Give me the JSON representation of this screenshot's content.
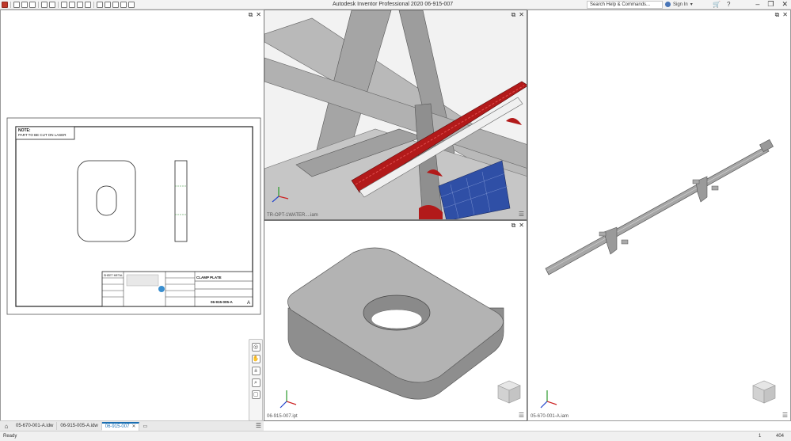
{
  "app": {
    "title": "Autodesk Inventor Professional 2020   06-915-007",
    "search_placeholder": "Search Help & Commands...",
    "user_name": "Sign In"
  },
  "drawing": {
    "note_title": "NOTE:",
    "note_text": "PART TO BE CUT ON LASER",
    "title_block": {
      "part_name": "CLAMP PLATE",
      "sheet_metal_label": "SHEET METAL",
      "drawing_number": "06-915-005-A",
      "revision": "A"
    }
  },
  "panes": {
    "top_center_label": "TR-OPT-1WATER....iam",
    "bottom_center_label": "06-915-007.ipt",
    "right_label": "05-670-001-A.iam"
  },
  "doc_tabs": [
    {
      "label": "05-670-001-A.idw",
      "active": false
    },
    {
      "label": "06-915-005-A.idw",
      "active": false
    },
    {
      "label": "06-915-007",
      "active": true
    }
  ],
  "status": {
    "text": "Ready",
    "num1": "1",
    "num2": "404"
  },
  "colors": {
    "accent": "#1a6fb3",
    "model_grey": "#a8a8a8",
    "beam_red": "#b21a1a",
    "panel_blue": "#2f4fa6"
  }
}
